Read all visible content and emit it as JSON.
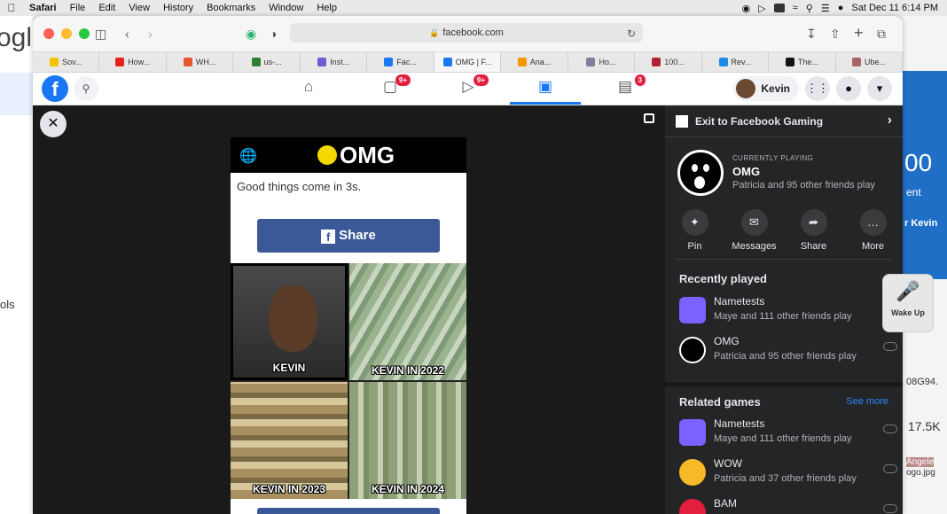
{
  "menubar": {
    "app": "Safari",
    "items": [
      "File",
      "Edit",
      "View",
      "History",
      "Bookmarks",
      "Window",
      "Help"
    ],
    "datetime": "Sat Dec 11  6:14 PM"
  },
  "background": {
    "google_fragment": "ogle",
    "left_text": "ols",
    "right_big": "00",
    "right_ent": "ent",
    "right_kevin": "r Kevin",
    "right_code": "08G94.",
    "right_views": "17.5K",
    "right_angele": "Angele",
    "right_jpg": "ogo.jpg"
  },
  "browser": {
    "url": "facebook.com",
    "tabs": [
      {
        "label": "Sov...",
        "color": "#f5c400"
      },
      {
        "label": "How...",
        "color": "#e62117"
      },
      {
        "label": "WH...",
        "color": "#e4572e"
      },
      {
        "label": "us-...",
        "color": "#2e7d32"
      },
      {
        "label": "Inst...",
        "color": "#6b5bd6"
      },
      {
        "label": "Fac...",
        "color": "#1877f2"
      },
      {
        "label": "OMG | F...",
        "color": "#1877f2",
        "active": true
      },
      {
        "label": "Ana...",
        "color": "#f29900"
      },
      {
        "label": "Ho...",
        "color": "#7e7e9a"
      },
      {
        "label": "100...",
        "color": "#b22234"
      },
      {
        "label": "Rev...",
        "color": "#1e88e5"
      },
      {
        "label": "The...",
        "color": "#111111"
      },
      {
        "label": "Ube...",
        "color": "#a66"
      }
    ]
  },
  "fbnav": {
    "logo": "f",
    "badges": {
      "watch": "9+",
      "marketplace": "9+",
      "pages": "3"
    },
    "user_name": "Kevin"
  },
  "game": {
    "logo": "OMG",
    "tagline": "Good things come in 3s.",
    "share_label": "Share",
    "captions": [
      "KEVIN",
      "KEVIN IN 2022",
      "KEVIN IN 2023",
      "KEVIN IN 2024"
    ]
  },
  "panel": {
    "exit_label": "Exit to Facebook Gaming",
    "currently_playing_label": "CURRENTLY PLAYING",
    "current_game": "OMG",
    "current_friends": "Patricia and 95 other friends play",
    "actions": [
      "Pin",
      "Messages",
      "Share",
      "More"
    ],
    "recently_played_title": "Recently played",
    "recent": [
      {
        "name": "Nametests",
        "friends": "Maye and 111 other friends play"
      },
      {
        "name": "OMG",
        "friends": "Patricia and 95 other friends play"
      }
    ],
    "related_title": "Related games",
    "see_more": "See more",
    "related": [
      {
        "name": "Nametests",
        "friends": "Maye and 111 other friends play"
      },
      {
        "name": "WOW",
        "friends": "Patricia and 37 other friends play"
      },
      {
        "name": "BAM",
        "friends": ""
      }
    ]
  },
  "wake": {
    "label": "Wake Up"
  }
}
